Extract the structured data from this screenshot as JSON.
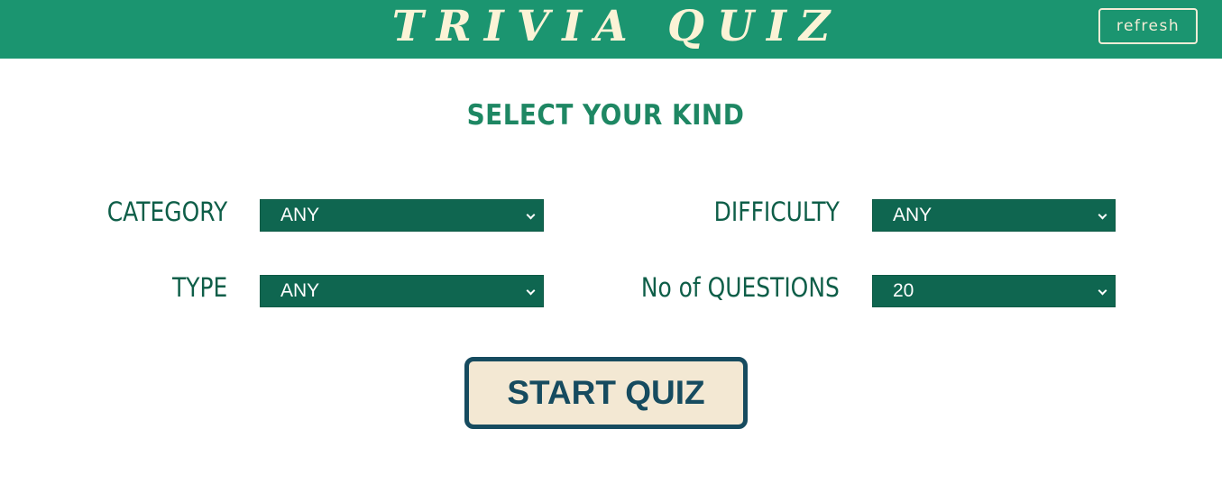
{
  "header": {
    "title": "TRIVIA QUIZ",
    "refresh_label": "refresh"
  },
  "main": {
    "heading": "SELECT YOUR KIND",
    "fields": {
      "category": {
        "label": "CATEGORY",
        "value": "ANY"
      },
      "difficulty": {
        "label": "DIFFICULTY",
        "value": "ANY"
      },
      "type": {
        "label": "TYPE",
        "value": "ANY"
      },
      "questions": {
        "label": "No of QUESTIONS",
        "value": "20"
      }
    },
    "start_label": "START QUIZ"
  },
  "colors": {
    "header_bg": "#1b9570",
    "title_text": "#fbf3d6",
    "heading_text": "#1e8763",
    "label_text": "#0e5e48",
    "select_bg": "#0f6650",
    "button_bg": "#f3e8d3",
    "button_border": "#164b5f"
  },
  "icons": {
    "select_arrow": "chevron-down-icon"
  }
}
